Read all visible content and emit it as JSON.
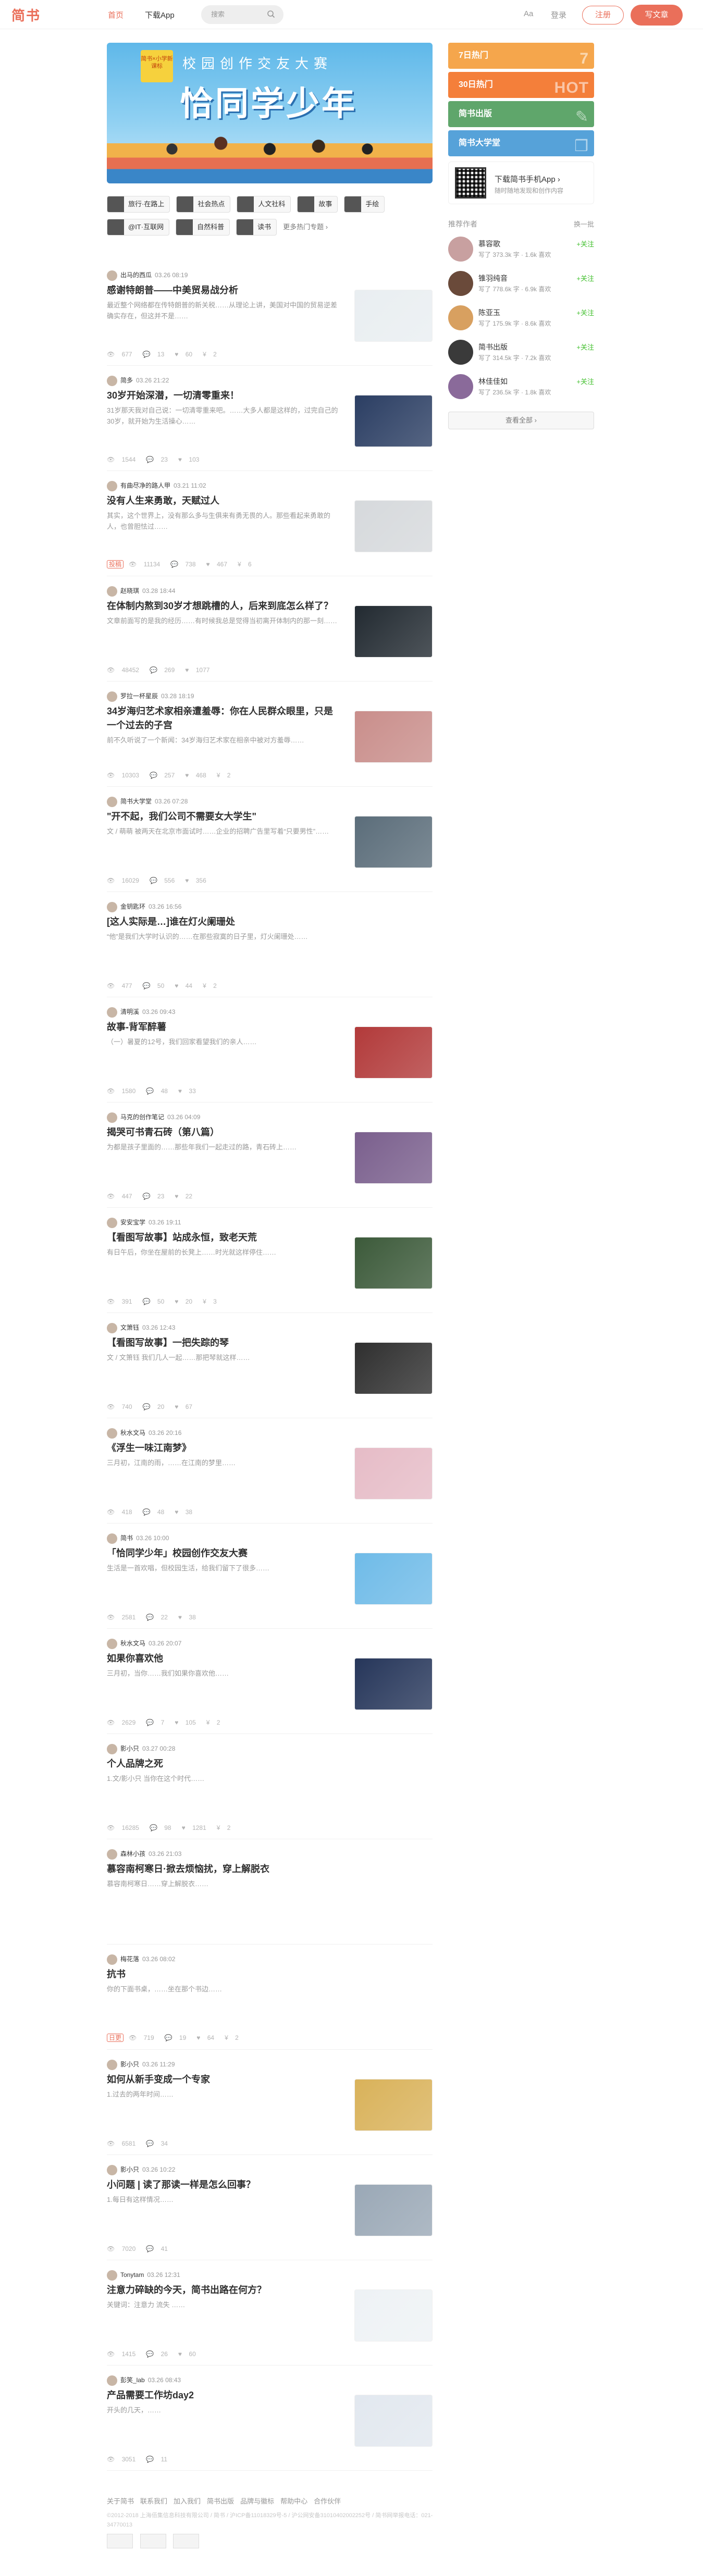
{
  "header": {
    "logo": "简书",
    "nav_home": "首页",
    "nav_app": "下载App",
    "search_placeholder": "搜索",
    "aa": "Aa",
    "login": "登录",
    "signup": "注册",
    "write": "写文章"
  },
  "banner": {
    "badge": "简书×小学新课标",
    "sub": "校园创作交友大赛",
    "title": "恰同学少年"
  },
  "topics": [
    {
      "label": "旅行·在路上"
    },
    {
      "label": "社会热点"
    },
    {
      "label": "人文社科"
    },
    {
      "label": "故事"
    },
    {
      "label": "手绘"
    },
    {
      "label": "@IT·互联网"
    },
    {
      "label": "自然科普"
    },
    {
      "label": "读书"
    }
  ],
  "topics_more": "更多热门专题 ›",
  "feed": [
    {
      "author": "出马的西瓜",
      "time": "03.26 08:19",
      "title": "感谢特朗普——中美贸易战分析",
      "abstract": "最近整个网络都在传特朗普的新关税……从理论上讲，美国对中国的贸易逆差确实存在，但这并不是……",
      "reads": "677",
      "comments": "13",
      "likes": "60",
      "rewards": "2",
      "img": true,
      "tone": "#e9eef1"
    },
    {
      "author": "简多",
      "time": "03.26 21:22",
      "title": "30岁开始深潜，一切清零重来！",
      "abstract": "31岁那天我对自己说：一切清零重来吧。……大多人都是这样的，过完自己的30岁，就开始为生活操心……",
      "reads": "1544",
      "comments": "23",
      "likes": "103",
      "rewards": "",
      "img": true,
      "tone": "#2b3e63"
    },
    {
      "author": "有曲尽净的路人甲",
      "time": "03.21 11:02",
      "title": "没有人生来勇敢，天赋过人",
      "abstract": "其实，这个世界上，没有那么多与生俱来有勇无畏的人。那些看起来勇敢的人，也曾胆怯过……",
      "reads": "11134",
      "comments": "738",
      "likes": "467",
      "rewards": "6",
      "tag": "投稿",
      "img": true,
      "tone": "#d6d9dc"
    },
    {
      "author": "赵晓琪",
      "time": "03.28 18:44",
      "title": "在体制内熬到30岁才想跳槽的人，后来到底怎么样了？",
      "abstract": "文章前面写的是我的经历……有时候我总是觉得当初离开体制内的那一刻……",
      "reads": "48452",
      "comments": "269",
      "likes": "1077",
      "rewards": "",
      "img": true,
      "tone": "#222a31"
    },
    {
      "author": "罗拉一杯星辰",
      "time": "03.28 18:19",
      "title": "34岁海归艺术家相亲遭羞辱：你在人民群众眼里，只是一个过去的子宫",
      "abstract": "前不久听说了一个新闻：34岁海归艺术家在相亲中被对方羞辱……",
      "reads": "10303",
      "comments": "257",
      "likes": "468",
      "rewards": "2",
      "img": true,
      "tone": "#c98e8b"
    },
    {
      "author": "简书大学堂",
      "time": "03.26 07:28",
      "title": "\"开不起，我们公司不需要女大学生\"",
      "abstract": "文 / 萌萌 被两天在北京市面试时……企业的招聘广告里写着“只要男性”……",
      "reads": "16029",
      "comments": "556",
      "likes": "356",
      "rewards": "",
      "img": true,
      "tone": "#5b6d7a"
    },
    {
      "author": "金钥匙环",
      "time": "03.26 16:56",
      "title": "[这人实际是…]谁在灯火阑珊处",
      "abstract": "“他”是我们大学时认识的……在那些寂寞的日子里，灯火阑珊处……",
      "reads": "477",
      "comments": "50",
      "likes": "44",
      "rewards": "2",
      "img": false
    },
    {
      "author": "清明溪",
      "time": "03.26 09:43",
      "title": "故事-背军醉薯",
      "abstract": "（一）暑夏的12号，我们回家看望我们的亲人……",
      "reads": "1580",
      "comments": "48",
      "likes": "33",
      "rewards": "",
      "img": true,
      "tone": "#b23a3a"
    },
    {
      "author": "马克的创作笔记",
      "time": "03.26 04:09",
      "title": "揭哭可书青石砖（第八篇）",
      "abstract": "为都是孩子里面的……那些年我们一起走过的路，青石砖上……",
      "reads": "447",
      "comments": "23",
      "likes": "22",
      "rewards": "",
      "img": true,
      "tone": "#7a5f8d"
    },
    {
      "author": "安安宝学",
      "time": "03.26 19:11",
      "title": "【看图写故事】站成永恒，致老天荒",
      "abstract": "有日午后，你坐在屋前的长凳上……时光就这样停住……",
      "reads": "391",
      "comments": "50",
      "likes": "20",
      "rewards": "3",
      "img": true,
      "tone": "#3c5a3a"
    },
    {
      "author": "文箫钰",
      "time": "03.26 12:43",
      "title": "【看图写故事】一把失踪的琴",
      "abstract": "文 / 文箫钰 我们几人一起……那把琴就这样……",
      "reads": "740",
      "comments": "20",
      "likes": "67",
      "rewards": "",
      "img": true,
      "tone": "#2f2f2f"
    },
    {
      "author": "秋水文马",
      "time": "03.26 20:16",
      "title": "《浮生一味江南梦》",
      "abstract": "三月初，江南的雨，……在江南的梦里……",
      "reads": "418",
      "comments": "48",
      "likes": "38",
      "rewards": "",
      "img": true,
      "tone": "#e6bcc7"
    },
    {
      "author": "简书",
      "time": "03.26 10:00",
      "title": "「恰同学少年」校园创作交友大赛",
      "abstract": "生活是一首欢唱，但校园生活，给我们留下了很多……",
      "reads": "2581",
      "comments": "22",
      "likes": "38",
      "rewards": "",
      "img": true,
      "tone": "#6fbbe8"
    },
    {
      "author": "秋水文马",
      "time": "03.26 20:07",
      "title": "如果你喜欢他",
      "abstract": "三月初，当你……我们如果你喜欢他……",
      "reads": "2629",
      "comments": "7",
      "likes": "105",
      "rewards": "2",
      "img": true,
      "tone": "#26365a"
    },
    {
      "author": "影小只",
      "time": "03.27 00:28",
      "title": "个人品牌之死",
      "abstract": "1.文/影小只 当你在这个时代……",
      "reads": "16285",
      "comments": "98",
      "likes": "1281",
      "rewards": "2",
      "img": false
    },
    {
      "author": "森林小孩",
      "time": "03.26 21:03",
      "title": "慕容南柯寒日·掀去烦恼扰，穿上解脱衣",
      "abstract": "慕容南柯寒日……穿上解脱衣……",
      "reads": "",
      "comments": "",
      "likes": "",
      "rewards": "",
      "img": false
    },
    {
      "author": "梅花落",
      "time": "03.26 08:02",
      "title": "抗书",
      "abstract": "你的下面书桌，……坐在那个书边……",
      "reads": "719",
      "comments": "19",
      "likes": "64",
      "rewards": "2",
      "tag": "日更",
      "img": false
    },
    {
      "author": "影小只",
      "time": "03.26 11:29",
      "title": "如何从新手变成一个专家",
      "abstract": "1.过去的两年时间……",
      "reads": "6581",
      "comments": "34",
      "likes": "",
      "rewards": "",
      "img": true,
      "tone": "#d9b25a"
    },
    {
      "author": "影小只",
      "time": "03.26 10:22",
      "title": "小问题 | 读了那读一样是怎么回事？",
      "abstract": "1.每日有这样情况……",
      "reads": "7020",
      "comments": "41",
      "likes": "",
      "rewards": "",
      "img": true,
      "tone": "#9aa8b6"
    },
    {
      "author": "Tonytam",
      "time": "03.26 12:31",
      "title": "注意力碎缺的今天，简书出路在何方？",
      "abstract": "关键词：注意力 流失 ……",
      "reads": "1415",
      "comments": "26",
      "likes": "60",
      "rewards": "",
      "img": true,
      "tone": "#eef2f5"
    },
    {
      "author": "彭笑_lab",
      "time": "03.26 08:43",
      "title": "产品需要工作坊day2",
      "abstract": "开头的几天，……",
      "reads": "3051",
      "comments": "11",
      "likes": "",
      "rewards": "",
      "img": true,
      "tone": "#e2e8ef"
    }
  ],
  "sidebar": {
    "boards": [
      {
        "label": "7日热门",
        "color": "#f5a64c",
        "deco": "7"
      },
      {
        "label": "30日热门",
        "color": "#f47f3a",
        "deco": "HOT"
      },
      {
        "label": "简书出版",
        "color": "#5fa66b",
        "deco": "✎"
      },
      {
        "label": "简书大学堂",
        "color": "#56a2d9",
        "deco": "❒"
      }
    ],
    "app_title": "下载简书手机App ›",
    "app_desc": "随时随地发现和创作内容",
    "rec_title": "推荐作者",
    "rec_swap": "换一批",
    "writers": [
      {
        "name": "慕容歌",
        "stats": "写了 373.3k 字 · 1.6k 喜欢",
        "follow": "+关注"
      },
      {
        "name": "锥羽纯音",
        "stats": "写了 778.6k 字 · 6.9k 喜欢",
        "follow": "+关注"
      },
      {
        "name": "陈亚玉",
        "stats": "写了 175.9k 字 · 8.6k 喜欢",
        "follow": "+关注"
      },
      {
        "name": "简书出版",
        "stats": "写了 314.5k 字 · 7.2k 喜欢",
        "follow": "+关注"
      },
      {
        "name": "林佳佳如",
        "stats": "写了 236.5k 字 · 1.8k 喜欢",
        "follow": "+关注"
      }
    ],
    "see_all": "查看全部 ›"
  },
  "footer": {
    "links": [
      "关于简书",
      "联系我们",
      "加入我们",
      "简书出版",
      "品牌与徽标",
      "帮助中心",
      "合作伙伴"
    ],
    "copyright": "©2012-2018 上海佰集信息科技有限公司 / 简书 / 沪ICP备11018329号-5 / 沪公网安备31010402002252号 / 简书网举报电话：021-34770013"
  }
}
